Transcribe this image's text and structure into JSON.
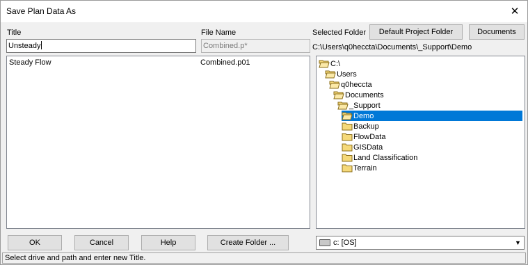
{
  "window": {
    "title": "Save Plan Data As",
    "close_glyph": "✕"
  },
  "labels": {
    "title": "Title",
    "file_name": "File Name",
    "selected_folder": "Selected Folder"
  },
  "inputs": {
    "title_value": "Unsteady",
    "file_name_value": "Combined.p*"
  },
  "buttons": {
    "default_project_folder": "Default Project Folder",
    "documents": "Documents",
    "ok": "OK",
    "cancel": "Cancel",
    "help": "Help",
    "create_folder": "Create Folder ..."
  },
  "selected_path": "C:\\Users\\q0heccta\\Documents\\_Support\\Demo",
  "plan_list": [
    {
      "title": "Steady Flow",
      "file": "Combined.p01"
    }
  ],
  "folder_tree": [
    {
      "label": "C:\\",
      "open": true,
      "selected": false
    },
    {
      "label": "Users",
      "open": true,
      "selected": false
    },
    {
      "label": "q0heccta",
      "open": true,
      "selected": false
    },
    {
      "label": "Documents",
      "open": true,
      "selected": false
    },
    {
      "label": "_Support",
      "open": true,
      "selected": false
    },
    {
      "label": "Demo",
      "open": true,
      "selected": true
    },
    {
      "label": "Backup",
      "open": false,
      "selected": false
    },
    {
      "label": "FlowData",
      "open": false,
      "selected": false
    },
    {
      "label": "GISData",
      "open": false,
      "selected": false
    },
    {
      "label": "Land Classification",
      "open": false,
      "selected": false
    },
    {
      "label": "Terrain",
      "open": false,
      "selected": false
    }
  ],
  "drive": {
    "value": "c: [OS]",
    "icon": "drive-icon"
  },
  "status_text": "Select drive and path and enter new Title.",
  "colors": {
    "selection": "#0078d7",
    "folder": "#f5d97a",
    "folder_border": "#8a6d1a"
  }
}
